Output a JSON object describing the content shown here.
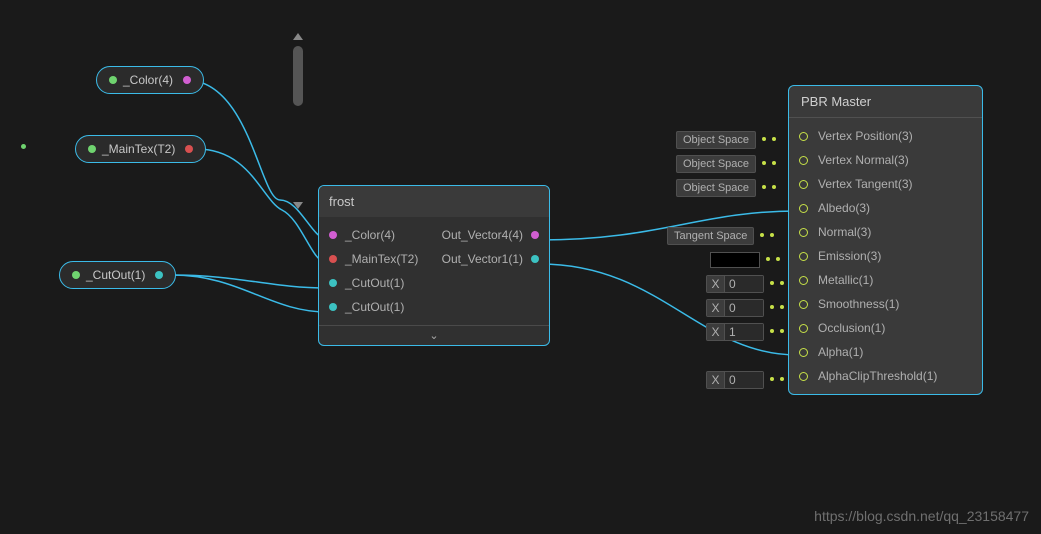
{
  "pills": {
    "color": {
      "label": "_Color(4)"
    },
    "maintex": {
      "label": "_MainTex(T2)"
    },
    "cutout": {
      "label": "_CutOut(1)"
    }
  },
  "frost": {
    "title": "frost",
    "inputs": {
      "color": "_Color(4)",
      "maintex": "_MainTex(T2)",
      "cutout1": "_CutOut(1)",
      "cutout2": "_CutOut(1)"
    },
    "outputs": {
      "vec4": "Out_Vector4(4)",
      "vec1": "Out_Vector1(1)"
    }
  },
  "master": {
    "title": "PBR Master",
    "rows": {
      "vpos": "Vertex Position(3)",
      "vnorm": "Vertex Normal(3)",
      "vtan": "Vertex Tangent(3)",
      "albedo": "Albedo(3)",
      "normal": "Normal(3)",
      "emis": "Emission(3)",
      "metal": "Metallic(1)",
      "smooth": "Smoothness(1)",
      "occ": "Occlusion(1)",
      "alpha": "Alpha(1)",
      "aclip": "AlphaClipThreshold(1)"
    }
  },
  "slots": {
    "objspace": "Object Space",
    "tanspace": "Tangent Space",
    "xlab": "X",
    "val0": "0",
    "val1": "1"
  },
  "watermark": "https://blog.csdn.net/qq_23158477"
}
